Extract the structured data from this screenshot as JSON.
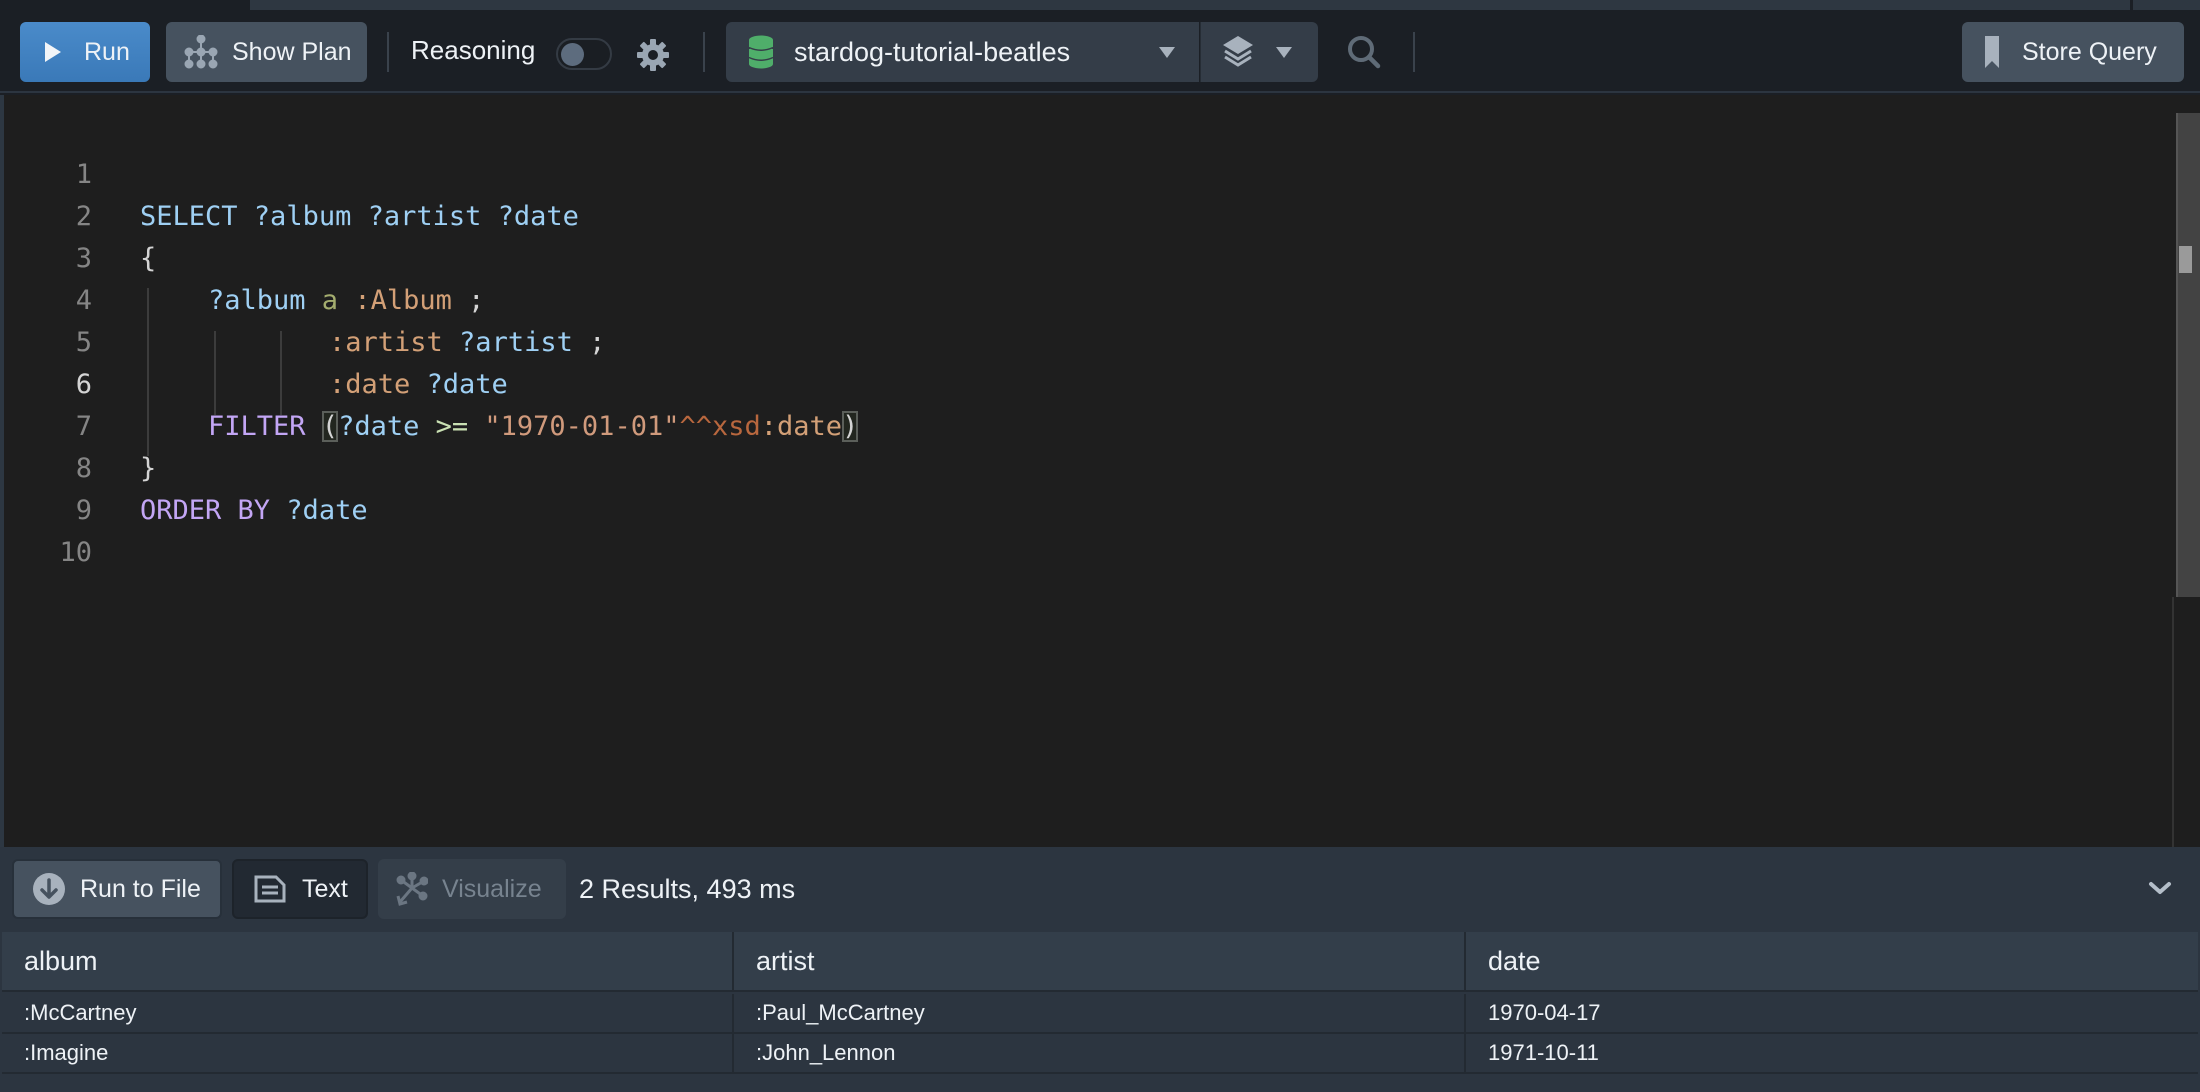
{
  "toolbar": {
    "run_label": "Run",
    "show_plan_label": "Show Plan",
    "reasoning_label": "Reasoning",
    "reasoning_enabled": false,
    "database": "stardog-tutorial-beatles",
    "store_query_label": "Store Query"
  },
  "editor": {
    "active_line": 6,
    "lines": [
      {
        "n": "1"
      },
      {
        "n": "2"
      },
      {
        "n": "3"
      },
      {
        "n": "4"
      },
      {
        "n": "5"
      },
      {
        "n": "6"
      },
      {
        "n": "7"
      },
      {
        "n": "8"
      },
      {
        "n": "9"
      },
      {
        "n": "10"
      }
    ],
    "tokens": {
      "l1_select": "SELECT",
      "l1_vars": " ?album ?artist ?date",
      "l2": "{",
      "l3_var": "?album",
      "l3_a": " a",
      "l3_class": " :Album",
      "l3_semi": " ;",
      "l4_pred": ":artist",
      "l4_var": " ?artist",
      "l4_semi": " ;",
      "l5_pred": ":date",
      "l5_var": " ?date",
      "l6_filter": "FILTER",
      "l6_open": "(",
      "l6_var": "?date",
      "l6_op": " >=",
      "l6_str": " \"1970-01-01\"",
      "l6_dt": "^^xsd",
      "l6_dtlocal": ":date",
      "l6_close": ")",
      "l7": "}",
      "l8_order": "ORDER BY",
      "l8_var": " ?date"
    }
  },
  "results": {
    "run_to_file_label": "Run to File",
    "text_label": "Text",
    "visualize_label": "Visualize",
    "summary": "2 Results,  493 ms",
    "columns": [
      "album",
      "artist",
      "date"
    ],
    "rows": [
      [
        ":McCartney",
        ":Paul_McCartney",
        "1970-04-17"
      ],
      [
        ":Imagine",
        ":John_Lennon",
        "1971-10-11"
      ]
    ]
  }
}
